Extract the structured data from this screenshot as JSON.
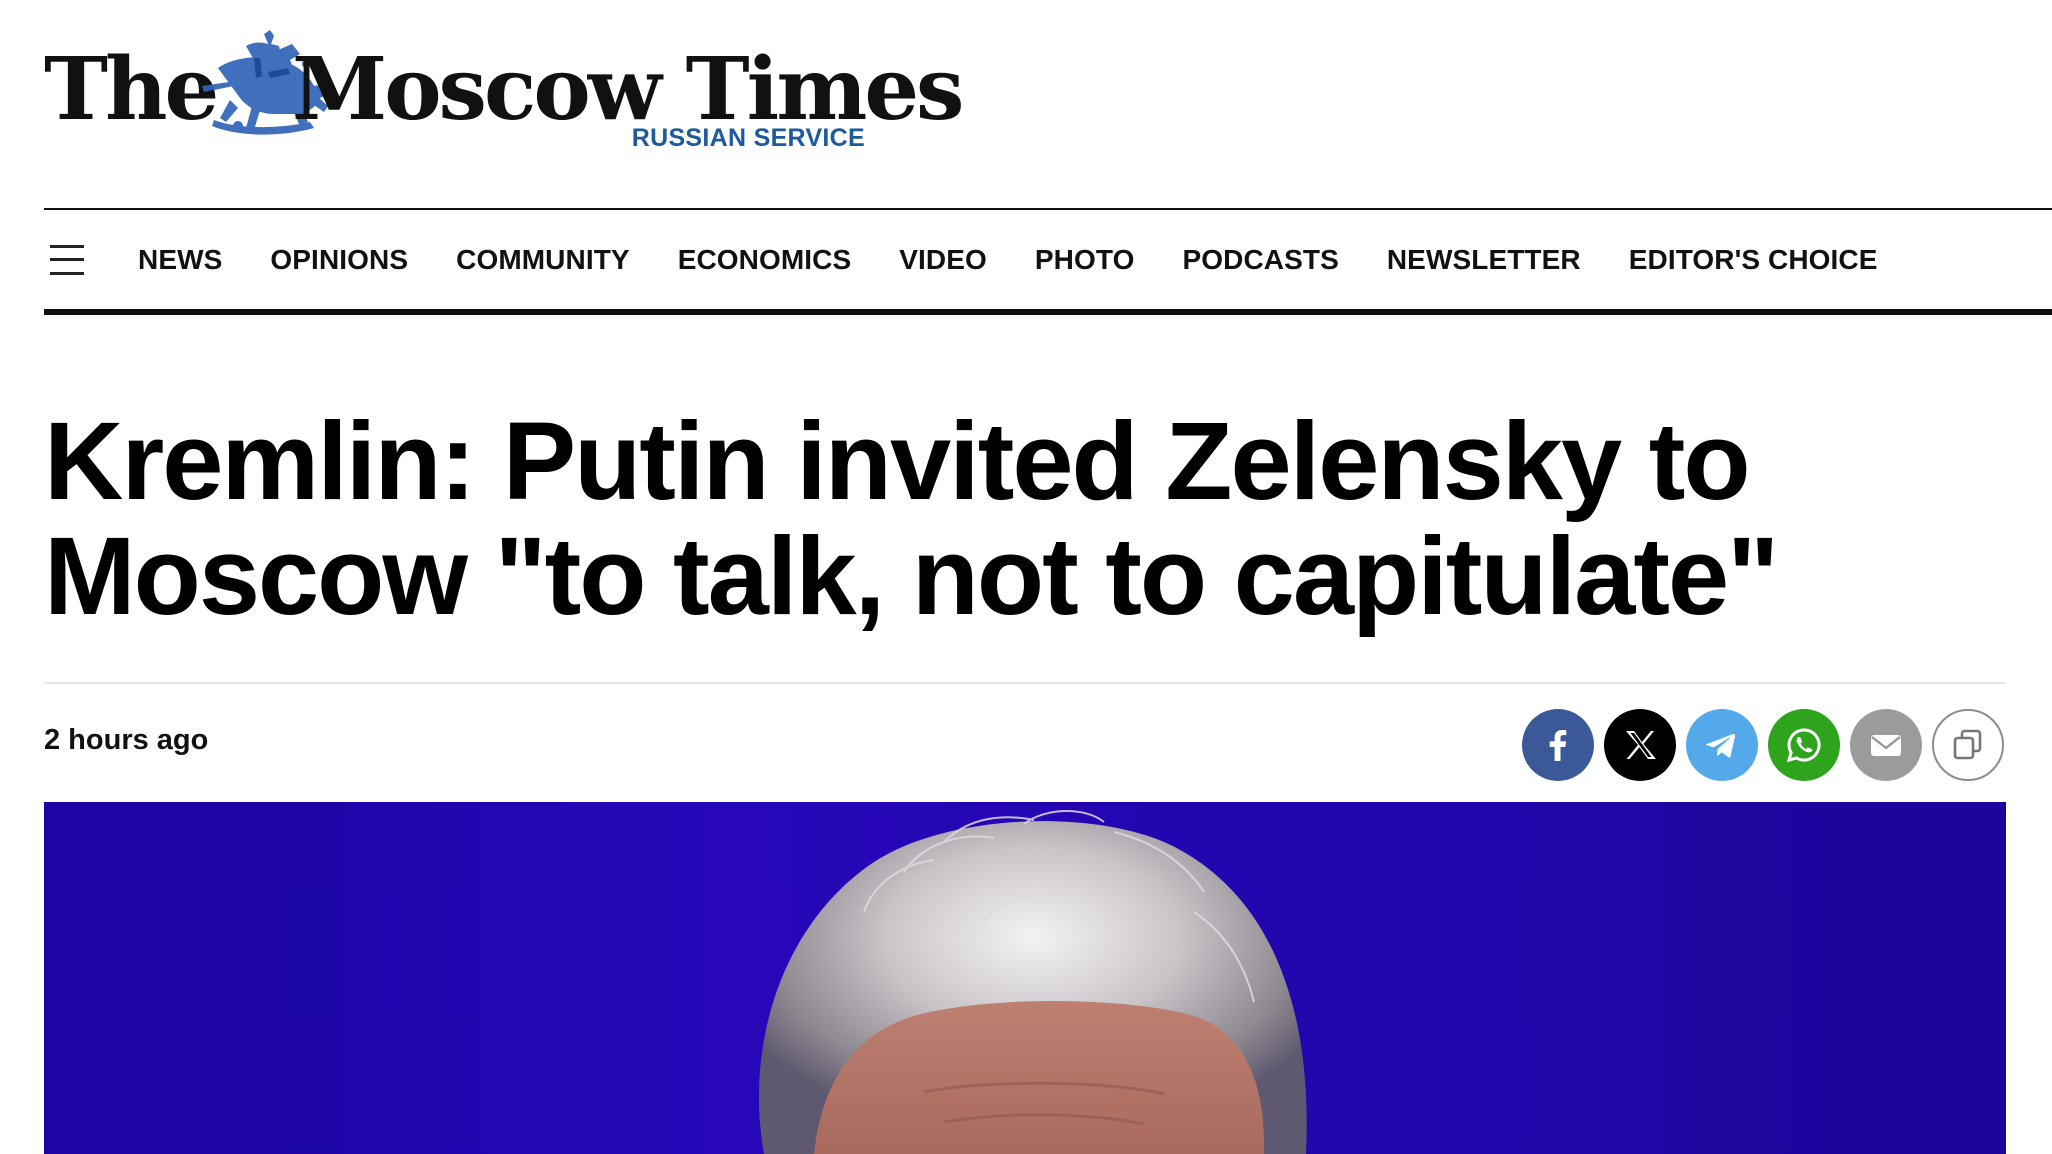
{
  "brand": {
    "word_the": "The",
    "word_rest": "Moscow Times",
    "service": "RUSSIAN SERVICE",
    "service_color": "#1d5a9e",
    "emblem_color": "#2f63b8"
  },
  "nav": {
    "menu_icon": "hamburger-menu-icon",
    "items": [
      {
        "label": "NEWS"
      },
      {
        "label": "OPINIONS"
      },
      {
        "label": "COMMUNITY"
      },
      {
        "label": "ECONOMICS"
      },
      {
        "label": "VIDEO"
      },
      {
        "label": "PHOTO"
      },
      {
        "label": "PODCASTS"
      },
      {
        "label": "NEWSLETTER"
      },
      {
        "label": "EDITOR'S CHOICE"
      }
    ]
  },
  "article": {
    "headline": "Kremlin: Putin invited Zelensky to Moscow \"to talk, not to capitulate\"",
    "timestamp": "2 hours ago",
    "hero_background": "#2406b0"
  },
  "share": {
    "buttons": [
      {
        "icon": "facebook-icon",
        "color": "#3b5998"
      },
      {
        "icon": "x-icon",
        "color": "#000000"
      },
      {
        "icon": "telegram-icon",
        "color": "#54a9eb"
      },
      {
        "icon": "whatsapp-icon",
        "color": "#2ea31c"
      },
      {
        "icon": "email-icon",
        "color": "#9b9b9b"
      },
      {
        "icon": "copy-link-icon",
        "color": "#ffffff"
      }
    ]
  }
}
